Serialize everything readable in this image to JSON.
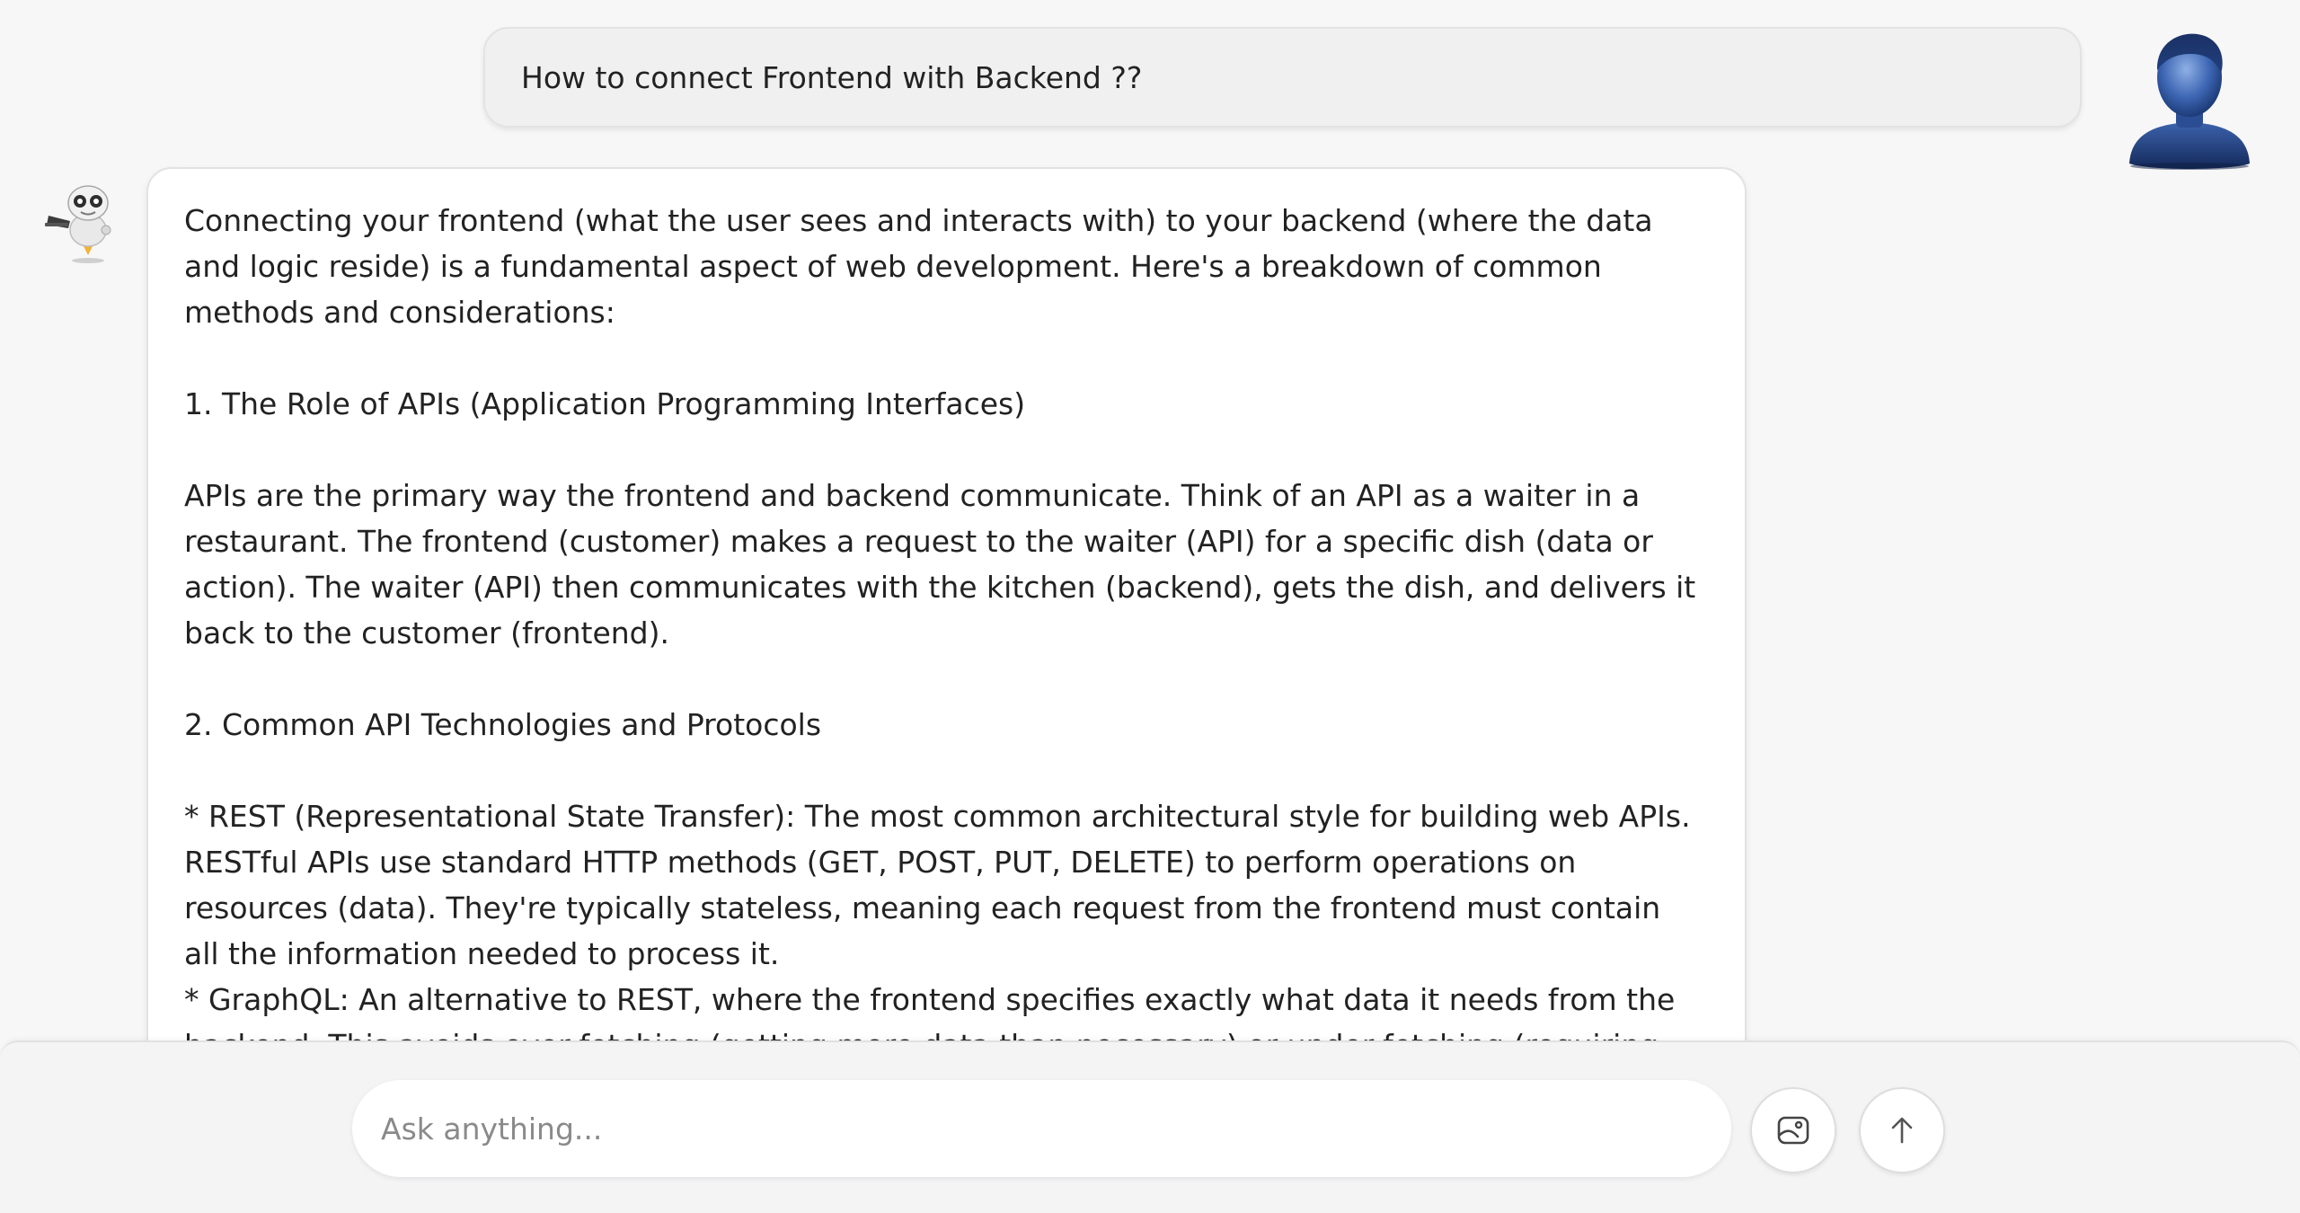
{
  "chat": {
    "user_message": "How to connect Frontend with Backend ??",
    "bot_paragraphs": [
      "Connecting your frontend (what the user sees and interacts with) to your backend (where the data and logic reside) is a fundamental aspect of web development. Here's a breakdown of common methods and considerations:",
      "1. The Role of APIs (Application Programming Interfaces)",
      "APIs are the primary way the frontend and backend communicate. Think of an API as a waiter in a restaurant. The frontend (customer) makes a request to the waiter (API) for a specific dish (data or action). The waiter (API) then communicates with the kitchen (backend), gets the dish, and delivers it back to the customer (frontend).",
      "2. Common API Technologies and Protocols",
      "* REST (Representational State Transfer): The most common architectural style for building web APIs. RESTful APIs use standard HTTP methods (GET, POST, PUT, DELETE) to perform operations on resources (data). They're typically stateless, meaning each request from the frontend must contain all the information needed to process it.",
      "* GraphQL: An alternative to REST, where the frontend specifies exactly what data it needs from the backend. This avoids over-fetching (getting more data than necessary) or under-fetching (requiring multiple requests)."
    ]
  },
  "composer": {
    "placeholder": "Ask anything..."
  },
  "icons": {
    "user_avatar": "person-avatar-icon",
    "bot_avatar": "robot-avatar-icon",
    "attach": "image-attach-icon",
    "send": "arrow-up-icon"
  },
  "colors": {
    "background": "#f7f7f8",
    "bubble_user": "#f0f0f0",
    "bubble_bot": "#ffffff",
    "avatar_blue": "#2d4f93"
  }
}
